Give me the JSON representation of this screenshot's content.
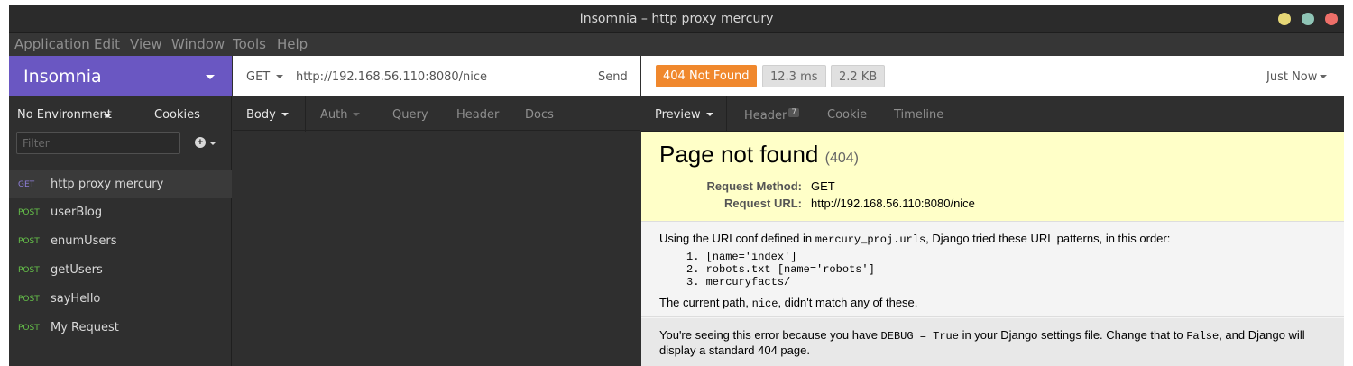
{
  "window": {
    "title": "Insomnia – http proxy mercury"
  },
  "menubar": [
    "Application",
    "Edit",
    "View",
    "Window",
    "Tools",
    "Help"
  ],
  "sidebar": {
    "brand": "Insomnia",
    "environment": "No Environment",
    "cookies": "Cookies",
    "filter_placeholder": "Filter",
    "requests": [
      {
        "method": "GET",
        "name": "http proxy mercury"
      },
      {
        "method": "POST",
        "name": "userBlog"
      },
      {
        "method": "POST",
        "name": "enumUsers"
      },
      {
        "method": "POST",
        "name": "getUsers"
      },
      {
        "method": "POST",
        "name": "sayHello"
      },
      {
        "method": "POST",
        "name": "My Request"
      }
    ]
  },
  "request": {
    "method": "GET",
    "url": "http://192.168.56.110:8080/nice",
    "send": "Send",
    "tabs": [
      "Body",
      "Auth",
      "Query",
      "Header",
      "Docs"
    ]
  },
  "response": {
    "status": "404 Not Found",
    "time": "12.3 ms",
    "size": "2.2 KB",
    "when": "Just Now",
    "tabs": [
      "Preview",
      "Header",
      "Cookie",
      "Timeline"
    ],
    "header_count": "7",
    "preview": {
      "title": "Page not found",
      "code": "(404)",
      "method_label": "Request Method:",
      "method_value": "GET",
      "url_label": "Request URL:",
      "url_value": "http://192.168.56.110:8080/nice",
      "urlconf_pre": "Using the URLconf defined in ",
      "urlconf_module": "mercury_proj.urls",
      "urlconf_post": ", Django tried these URL patterns, in this order:",
      "patterns": [
        "1. [name='index']",
        "2. robots.txt [name='robots']",
        "3. mercuryfacts/"
      ],
      "path_pre": "The current path, ",
      "path_value": "nice",
      "path_post": ", didn't match any of these.",
      "debug_pre": "You're seeing this error because you have ",
      "debug_code": "DEBUG = True",
      "debug_mid": " in your Django settings file. Change that to ",
      "debug_false": "False",
      "debug_post": ", and Django will display a standard 404 page."
    }
  },
  "colors": {
    "brand": "#6a57c2",
    "get": "#8e7fd9",
    "post": "#66c24a",
    "status": "#f0882d"
  }
}
